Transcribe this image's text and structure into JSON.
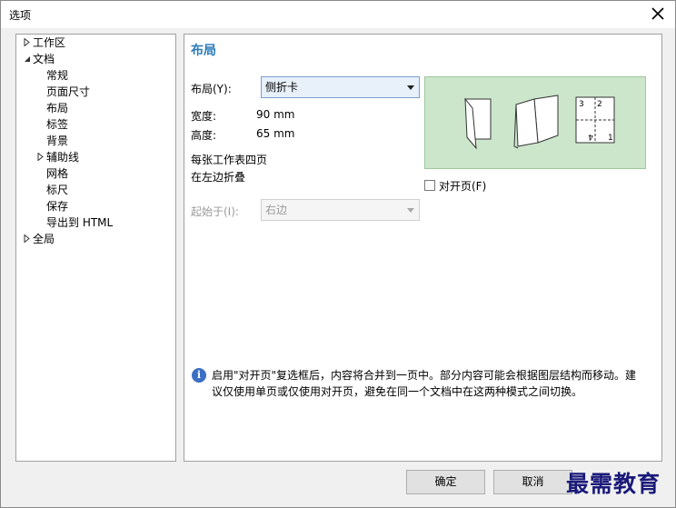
{
  "window": {
    "title": "选项"
  },
  "tree": {
    "items": [
      {
        "label": "工作区",
        "arrow": "right"
      },
      {
        "label": "文档",
        "arrow": "down"
      },
      {
        "label": "常规"
      },
      {
        "label": "页面尺寸"
      },
      {
        "label": "布局",
        "selected": true
      },
      {
        "label": "标签"
      },
      {
        "label": "背景"
      },
      {
        "label": "辅助线",
        "arrow": "right"
      },
      {
        "label": "网格"
      },
      {
        "label": "标尺"
      },
      {
        "label": "保存"
      },
      {
        "label": "导出到 HTML"
      },
      {
        "label": "全局",
        "arrow": "right"
      }
    ]
  },
  "panel": {
    "title": "布局",
    "layout_label": "布局(Y):",
    "layout_value": "侧折卡",
    "width_label": "宽度:",
    "width_value": "90 mm",
    "height_label": "高度:",
    "height_value": "65 mm",
    "desc_line1": "每张工作表四页",
    "desc_line2": "在左边折叠",
    "start_label": "起始于(I):",
    "start_value": "右边",
    "facing_label": "对开页(F)",
    "preview_nums": {
      "tl": "3",
      "tr": "2",
      "bl": "4",
      "br": "1"
    },
    "info_text": "启用\"对开页\"复选框后，内容将合并到一页中。部分内容可能会根据图层结构而移动。建议仅使用单页或仅使用对开页，避免在同一个文档中在这两种模式之间切换。"
  },
  "buttons": {
    "ok": "确定",
    "cancel": "取消"
  },
  "watermark": "最需教育",
  "colors": {
    "accent": "#2a7ab8",
    "preview_bg": "#cce6cc"
  }
}
